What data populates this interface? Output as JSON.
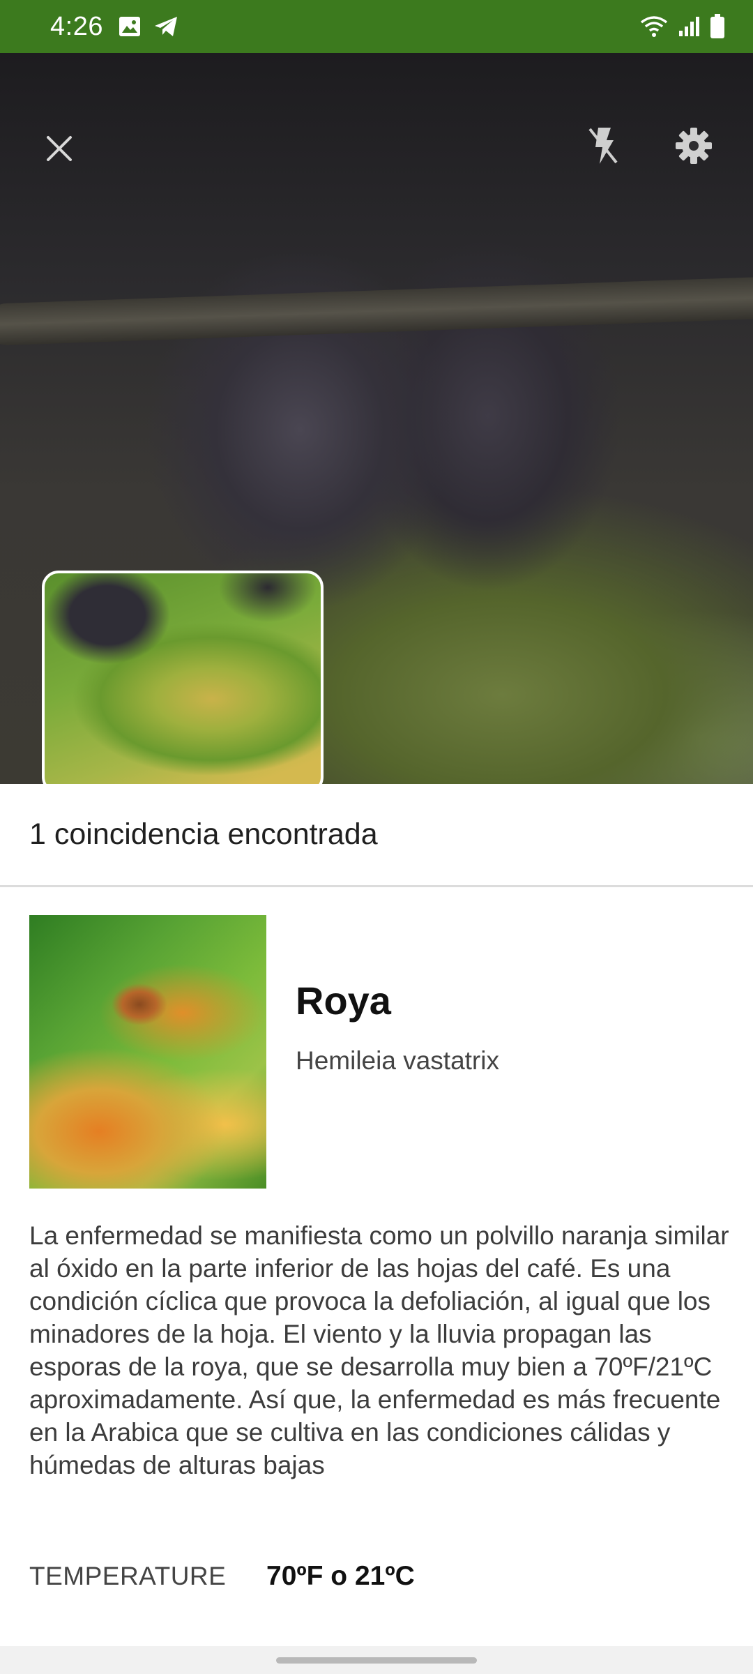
{
  "status_bar": {
    "time": "4:26",
    "icons_left": [
      "image-icon",
      "telegram-icon"
    ],
    "icons_right": [
      "wifi-icon",
      "signal-icon",
      "battery-icon"
    ],
    "background_color": "#3c7a1e"
  },
  "camera": {
    "close_icon": "close-icon",
    "flash_icon": "flash-off-icon",
    "settings_icon": "gear-icon"
  },
  "results": {
    "header": "1 coincidencia encontrada",
    "item": {
      "title": "Roya",
      "subtitle": "Hemileia vastatrix",
      "description": "La enfermedad se manifiesta como un polvillo naranja similar al óxido en la parte inferior de las hojas del café. Es una condición cíclica que provoca la defoliación, al igual que los minadores de la hoja. El viento y la lluvia propagan las esporas de la roya, que se desarrolla muy bien a 70ºF/21ºC aproximadamente. Así que, la enfermedad es más frecuente en la Arabica que se cultiva en las condiciones cálidas y húmedas de alturas bajas",
      "attributes": [
        {
          "label": "TEMPERATURE",
          "value": "70ºF o 21ºC"
        }
      ]
    }
  }
}
